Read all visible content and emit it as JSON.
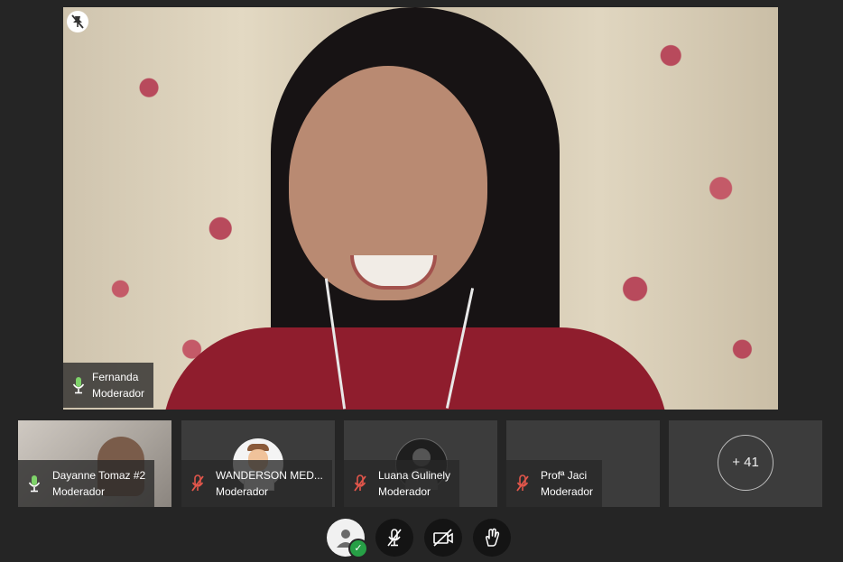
{
  "main_speaker": {
    "name": "Fernanda",
    "role": "Moderador",
    "pin_icon": "pin-off-icon"
  },
  "thumbnails": [
    {
      "name": "Dayanne Tomaz #2",
      "role": "Moderador",
      "mic": "mic-on"
    },
    {
      "name": "WANDERSON MED...",
      "role": "Moderador",
      "mic": "mic-muted"
    },
    {
      "name": "Luana Gulinely",
      "role": "Moderador",
      "mic": "mic-muted"
    },
    {
      "name": "Profª Jaci",
      "role": "Moderador",
      "mic": "mic-muted"
    }
  ],
  "more_participants": {
    "label": "+ 41"
  },
  "controls": {
    "user_status": "available",
    "mic": "muted",
    "camera": "off",
    "raise_hand": "hand-icon"
  },
  "colors": {
    "background": "#252525",
    "tile": "#3c3c3c",
    "mic_on": "#7fd36a",
    "mic_muted": "#e2564b",
    "status_ok": "#27a046"
  }
}
